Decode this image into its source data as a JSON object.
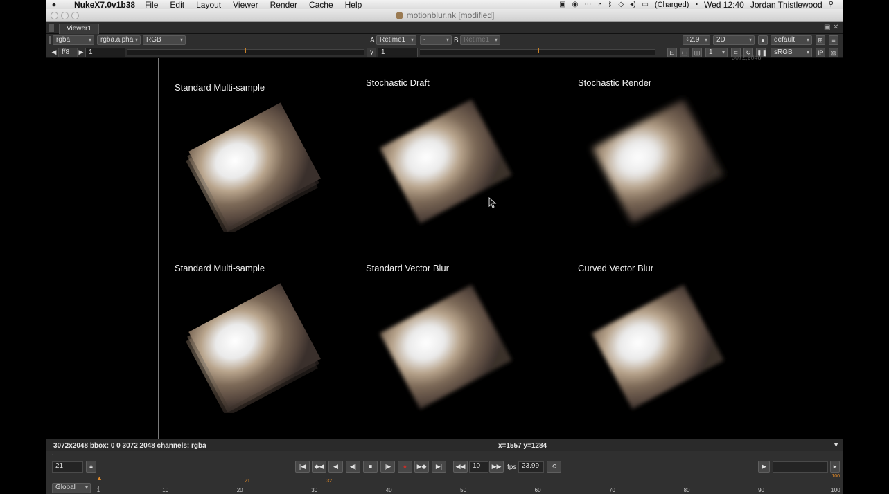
{
  "menubar": {
    "app_name": "NukeX7.0v1b38",
    "menus": [
      "File",
      "Edit",
      "Layout",
      "Viewer",
      "Render",
      "Cache",
      "Help"
    ],
    "battery": "(Charged)",
    "clock": "Wed 12:40",
    "user": "Jordan Thistlewood"
  },
  "window": {
    "title": "motionblur.nk [modified]"
  },
  "viewer": {
    "tab_label": "Viewer1",
    "channels": "rgba",
    "alpha_channel": "rgba.alpha",
    "display": "RGB",
    "input_a_label": "A",
    "input_a": "Retime1",
    "wipe_op": "-",
    "input_b_label": "B",
    "input_b": "Retime1",
    "gain": "f/8",
    "gain_value": "1",
    "gamma_label": "y",
    "gamma_value": "1",
    "zoom": "÷2.9",
    "view_mode": "2D",
    "lut": "default",
    "proxy_value": "1",
    "colorspace": "sRGB",
    "ip_label": "IP",
    "resolution_label": "3072,2048",
    "captions": [
      "Standard Multi-sample",
      "Stochastic Draft",
      "Stochastic Render",
      "Standard Multi-sample",
      "Standard Vector Blur",
      "Curved Vector Blur"
    ]
  },
  "info_bar": {
    "format": "3072x2048 bbox: 0 0 3072 2048 channels: rgba",
    "coords": "x=1557 y=1284"
  },
  "playback": {
    "current_frame": "21",
    "increment": "10",
    "fps_label": "fps",
    "fps": "23.99",
    "range_mode": "Global",
    "range_end": "100",
    "keyframes": [
      21,
      32
    ],
    "ticks": [
      "1",
      "10",
      "20",
      "30",
      "40",
      "50",
      "60",
      "70",
      "80",
      "90",
      "100"
    ]
  },
  "colors": {
    "accent_orange": "#c8822a",
    "panel_bg": "#303030",
    "record_red": "#c0302a"
  }
}
